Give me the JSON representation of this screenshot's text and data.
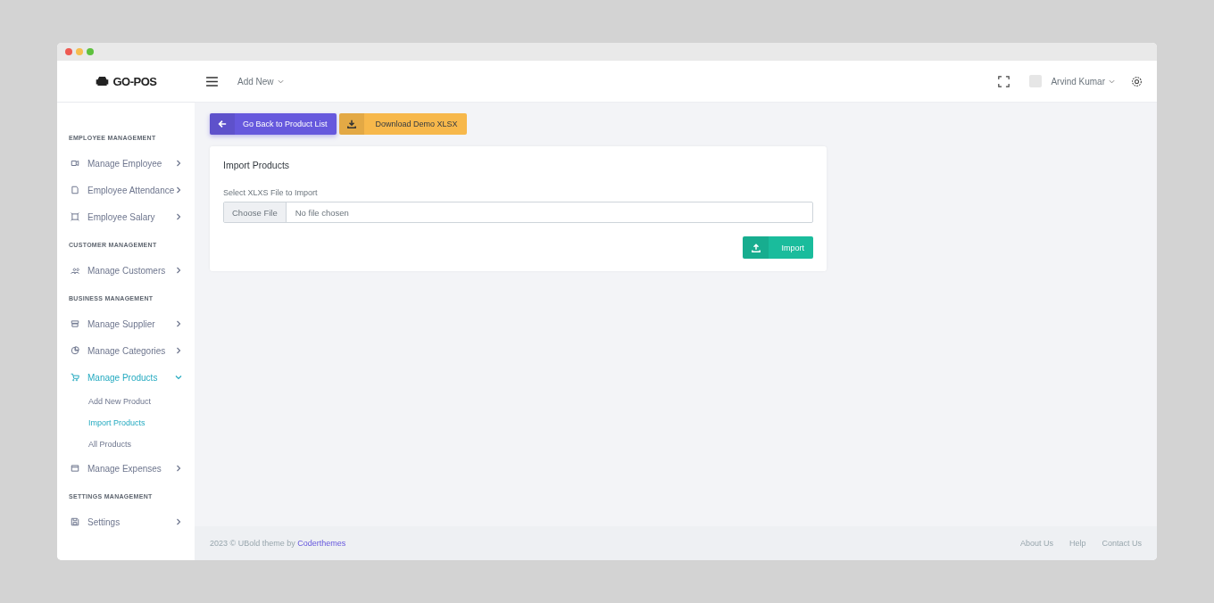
{
  "topbar": {
    "logo": "GO-POS",
    "add_new": "Add New",
    "user": "Arvind Kumar"
  },
  "sidebar": {
    "sections": [
      {
        "title": "EMPLOYEE MANAGEMENT",
        "items": [
          {
            "label": "Manage Employee",
            "selected": false,
            "expanded": false
          },
          {
            "label": "Employee Attendance",
            "selected": false,
            "expanded": false
          },
          {
            "label": "Employee Salary",
            "selected": false,
            "expanded": false
          }
        ]
      },
      {
        "title": "CUSTOMER MANAGEMENT",
        "items": [
          {
            "label": "Manage Customers",
            "selected": false,
            "expanded": false
          }
        ]
      },
      {
        "title": "BUSINESS MANAGEMENT",
        "items": [
          {
            "label": "Manage Supplier",
            "selected": false,
            "expanded": false
          },
          {
            "label": "Manage Categories",
            "selected": false,
            "expanded": false
          },
          {
            "label": "Manage Products",
            "selected": true,
            "expanded": true,
            "children": [
              {
                "label": "Add New Product",
                "selected": false
              },
              {
                "label": "Import Products",
                "selected": true
              },
              {
                "label": "All Products",
                "selected": false
              }
            ]
          },
          {
            "label": "Manage Expenses",
            "selected": false,
            "expanded": false
          }
        ]
      },
      {
        "title": "SETTINGS MANAGEMENT",
        "items": [
          {
            "label": "Settings",
            "selected": false,
            "expanded": false
          }
        ]
      }
    ]
  },
  "actions": [
    {
      "label": "Go Back to Product List",
      "kind": "back"
    },
    {
      "label": "Download Demo XLSX",
      "kind": "download"
    }
  ],
  "card": {
    "title": "Import Products",
    "field_label": "Select XLXS File to Import",
    "file_button": "Choose File",
    "file_status": "No file chosen",
    "submit": "Import"
  },
  "footer": {
    "text": "2023 © UBold theme by ",
    "link": "Coderthemes",
    "links": [
      "About Us",
      "Help",
      "Contact Us"
    ]
  }
}
